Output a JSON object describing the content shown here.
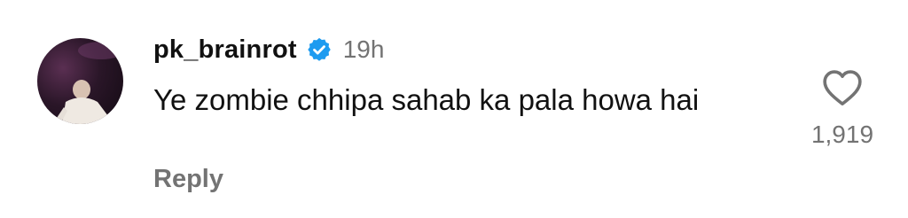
{
  "comment": {
    "username": "pk_brainrot",
    "verified_icon": "verified-badge-icon",
    "time": "19h",
    "text": "Ye zombie chhipa sahab ka pala howa hai",
    "reply_label": "Reply",
    "like_icon": "heart-outline-icon",
    "like_count": "1,919",
    "colors": {
      "verified": "#1d9bf0",
      "muted_text": "#737373",
      "primary_text": "#111111"
    }
  }
}
